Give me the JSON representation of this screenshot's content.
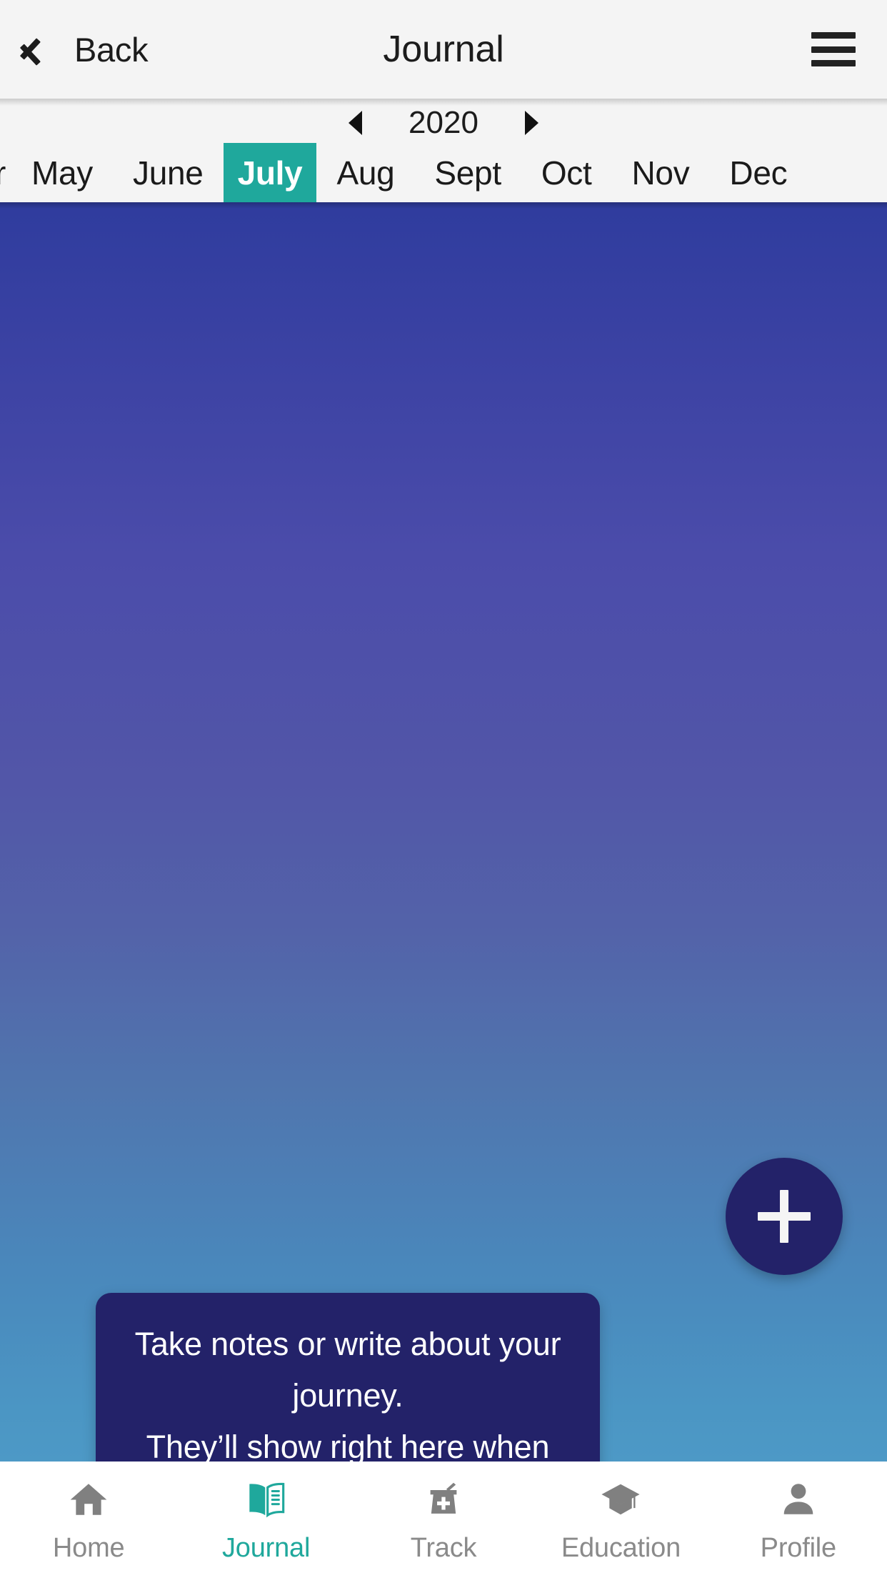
{
  "header": {
    "back_label": "Back",
    "title": "Journal",
    "menu_icon": "hamburger-menu-icon",
    "back_icon": "chevron-left-icon"
  },
  "calendar": {
    "year": "2020",
    "prev_icon": "triangle-left-icon",
    "next_icon": "triangle-right-icon",
    "selected_month": "July",
    "months": [
      {
        "label": "r",
        "clipped": true,
        "active": false
      },
      {
        "label": "May",
        "clipped": false,
        "active": false
      },
      {
        "label": "June",
        "clipped": false,
        "active": false
      },
      {
        "label": "July",
        "clipped": false,
        "active": true
      },
      {
        "label": "Aug",
        "clipped": false,
        "active": false
      },
      {
        "label": "Sept",
        "clipped": false,
        "active": false
      },
      {
        "label": "Oct",
        "clipped": false,
        "active": false
      },
      {
        "label": "Nov",
        "clipped": false,
        "active": false
      },
      {
        "label": "Dec",
        "clipped": false,
        "active": false
      }
    ]
  },
  "tooltip": {
    "line1": "Take notes or write about your journey.",
    "line2": "They’ll show right here when you’re done."
  },
  "fab": {
    "icon": "plus-icon",
    "label": "Add journal entry"
  },
  "tabbar": {
    "items": [
      {
        "label": "Home",
        "icon": "home-icon",
        "active": false
      },
      {
        "label": "Journal",
        "icon": "open-book-icon",
        "active": true
      },
      {
        "label": "Track",
        "icon": "mortar-pestle-plus-icon",
        "active": false
      },
      {
        "label": "Education",
        "icon": "graduation-cap-icon",
        "active": false
      },
      {
        "label": "Profile",
        "icon": "person-icon",
        "active": false
      }
    ]
  },
  "colors": {
    "accent_teal": "#1fa89c",
    "tooltip_navy": "#232269",
    "gradient_top": "#2f3c9e",
    "gradient_mid": "#5256a8",
    "gradient_bottom": "#4b96c4",
    "header_bg": "#f4f4f4",
    "inactive_gray": "#8a8a8a"
  }
}
